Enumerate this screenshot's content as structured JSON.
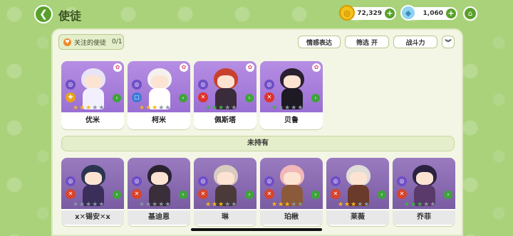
{
  "header": {
    "back_icon": "back-arrow-icon",
    "title": "使徒",
    "coins": "72,329",
    "gems": "1,060",
    "home_icon": "home-icon"
  },
  "toolbar": {
    "follow_label": "关注的使徒",
    "follow_count": "0/1",
    "emotion_label": "情感表达",
    "filter_label": "筛选 开",
    "power_label": "战斗力",
    "collapse_icon": "double-chevron-down-icon"
  },
  "owned": [
    {
      "name": "优米",
      "stars": [
        "on",
        "on",
        "on",
        "off",
        "off"
      ],
      "hair": "#e8e4f5",
      "outfit": "#f2f0ff",
      "role_icon": "✚",
      "role_color": "#e9a21c"
    },
    {
      "name": "柯米",
      "stars": [
        "on",
        "on",
        "on",
        "off",
        "off"
      ],
      "hair": "#f4f1f1",
      "outfit": "#ffffff",
      "role_icon": "▢",
      "role_color": "#3a7ad9"
    },
    {
      "name": "佩斯塔",
      "stars": [
        "green",
        "green",
        "green",
        "off",
        "off"
      ],
      "hair": "#c9412e",
      "outfit": "#3a2c3a",
      "role_icon": "✕",
      "role_color": "#e0332b"
    },
    {
      "name": "贝鲁",
      "stars": [
        "green",
        "off",
        "off",
        "off",
        "off"
      ],
      "hair": "#2a1f2f",
      "outfit": "#1d1a24",
      "role_icon": "✕",
      "role_color": "#e0332b"
    }
  ],
  "section_unowned": "未持有",
  "unowned": [
    {
      "name": "x✕锡安✕x",
      "stars": [
        "off",
        "off",
        "off",
        "off",
        "off"
      ],
      "hair": "#2c3550",
      "outfit": "#3a2e5a",
      "role_icon": "✕"
    },
    {
      "name": "基迪恩",
      "stars": [
        "off",
        "off",
        "off",
        "off",
        "off"
      ],
      "hair": "#2a2430",
      "outfit": "#3a2e3a",
      "role_icon": "✕"
    },
    {
      "name": "琳",
      "stars": [
        "on",
        "on",
        "on",
        "off",
        "off"
      ],
      "hair": "#d8cbbf",
      "outfit": "#4a3a3a",
      "role_icon": "✕"
    },
    {
      "name": "珀楸",
      "stars": [
        "on",
        "on",
        "on",
        "off",
        "off"
      ],
      "hair": "#f0b8b8",
      "outfit": "#8a5a3a",
      "role_icon": "✕"
    },
    {
      "name": "莱薇",
      "stars": [
        "on",
        "on",
        "on",
        "off",
        "off"
      ],
      "hair": "#e0dcd8",
      "outfit": "#6a3a2a",
      "role_icon": "✕"
    },
    {
      "name": "乔菲",
      "stars": [
        "green",
        "green",
        "green",
        "off",
        "off"
      ],
      "hair": "#2a2240",
      "outfit": "#5a3a6a",
      "role_icon": "✕"
    }
  ]
}
